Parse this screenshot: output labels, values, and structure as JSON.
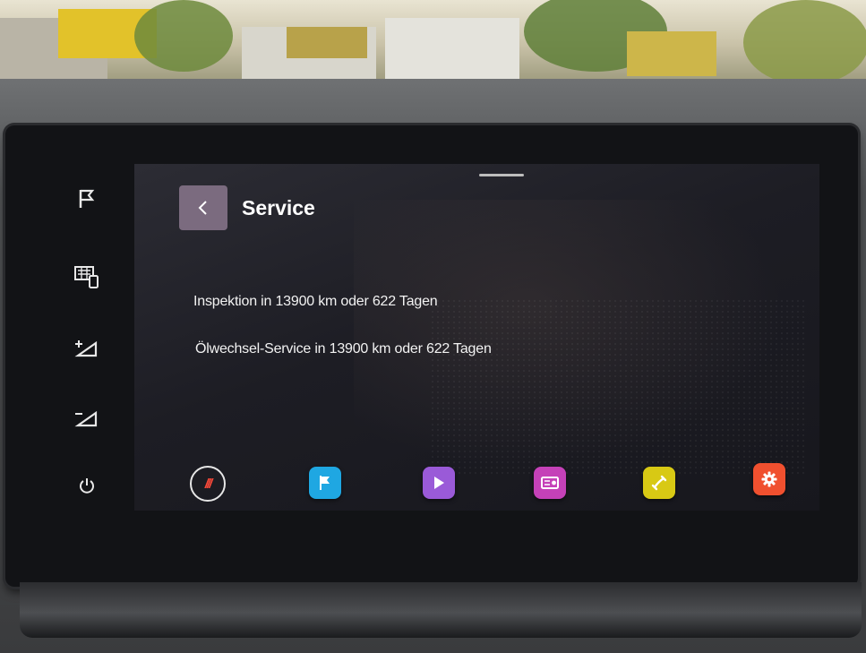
{
  "header": {
    "title": "Service",
    "back_icon": "chevron-left-icon"
  },
  "messages": [
    "Inspektion in 13900 km oder 622 Tagen",
    "Ölwechsel-Service in 13900 km oder 622 Tagen"
  ],
  "side_buttons": [
    {
      "icon": "flag-icon"
    },
    {
      "icon": "car-settings-icon"
    },
    {
      "icon": "volume-up-icon"
    },
    {
      "icon": "volume-down-icon"
    },
    {
      "icon": "power-icon"
    }
  ],
  "dock": {
    "home": {
      "label": "///",
      "color": "#ff4a3a"
    },
    "items": [
      {
        "icon": "navigation-flag-icon",
        "color": "#1fa7e2"
      },
      {
        "icon": "media-play-icon",
        "color": "#9a5ad8"
      },
      {
        "icon": "radio-icon",
        "color": "#c541b8"
      },
      {
        "icon": "phone-icon",
        "color": "#d8c914"
      },
      {
        "icon": "settings-gear-icon",
        "color": "#f0502f"
      }
    ]
  }
}
